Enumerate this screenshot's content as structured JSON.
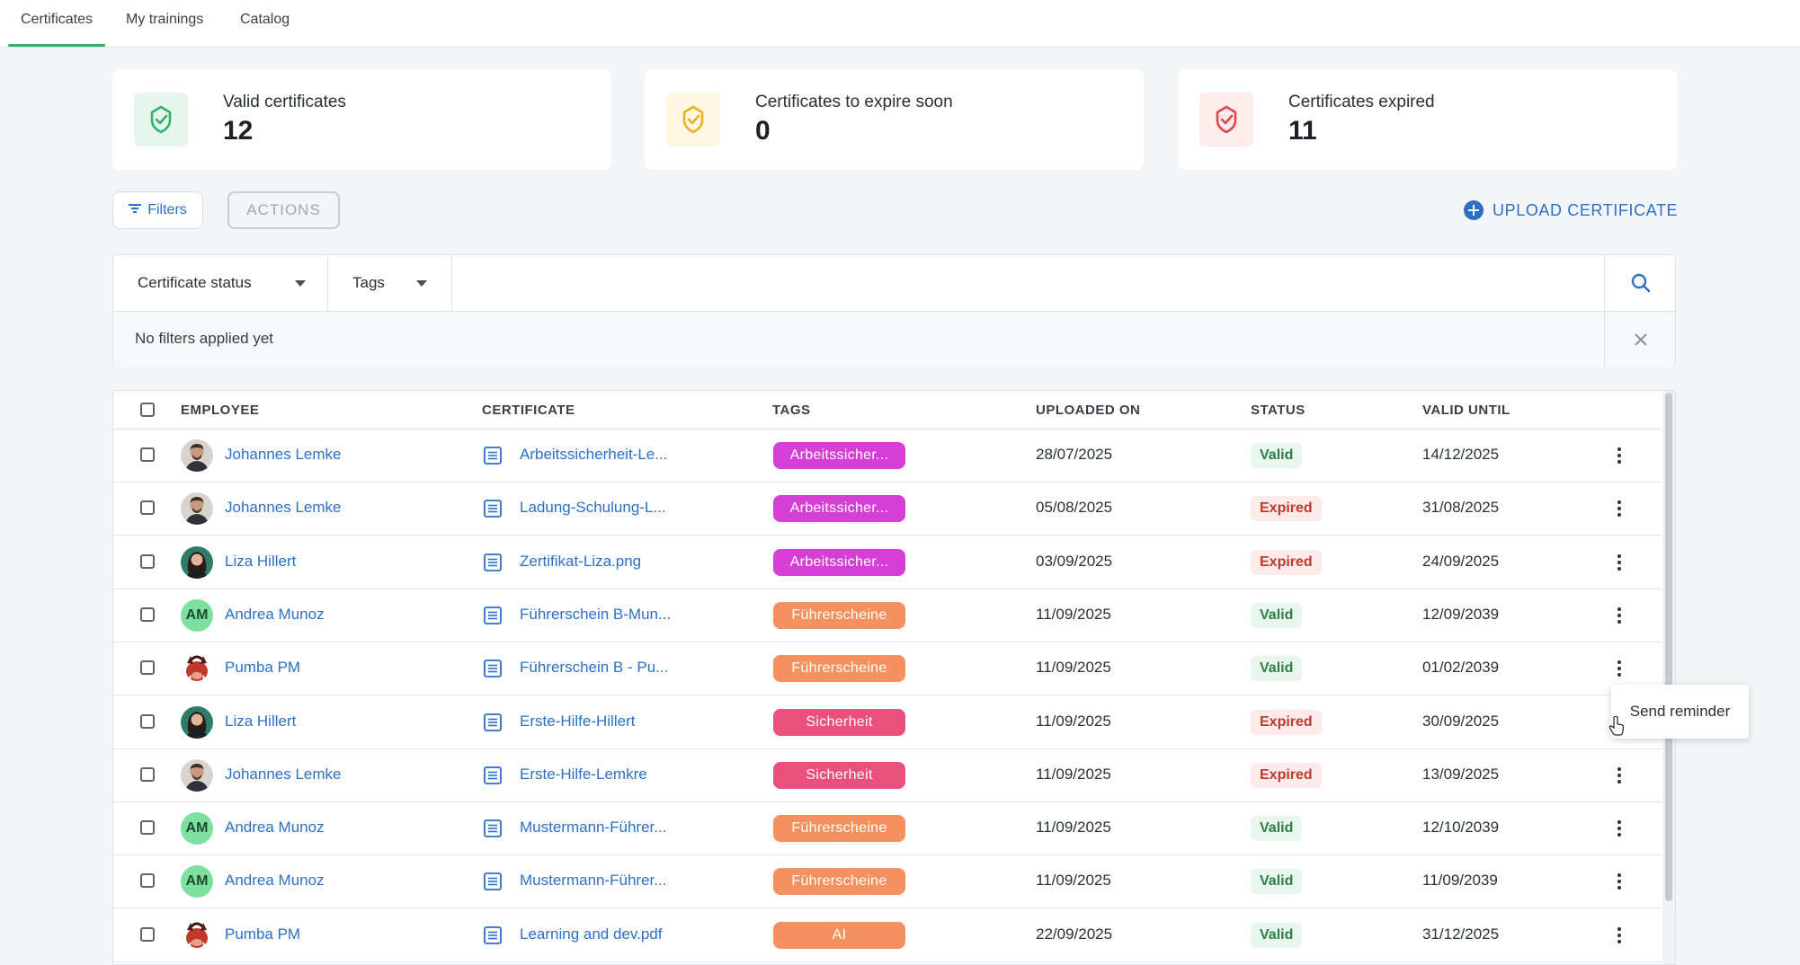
{
  "nav": {
    "tabs": [
      {
        "label": "Certificates",
        "active": true
      },
      {
        "label": "My trainings",
        "active": false
      },
      {
        "label": "Catalog",
        "active": false
      }
    ]
  },
  "stats": [
    {
      "label": "Valid certificates",
      "value": "12",
      "icon": "award-check-icon",
      "color": "#2fb36b"
    },
    {
      "label": "Certificates to expire soon",
      "value": "0",
      "icon": "award-warning-icon",
      "color": "#e6b31e"
    },
    {
      "label": "Certificates expired",
      "value": "11",
      "icon": "award-expired-icon",
      "color": "#e0454b"
    }
  ],
  "toolbar": {
    "filters_label": "Filters",
    "actions_label": "ACTIONS",
    "upload_label": "UPLOAD CERTIFICATE"
  },
  "filters": {
    "status_label": "Certificate status",
    "tags_label": "Tags",
    "search_placeholder": "",
    "no_filters_text": "No filters applied yet"
  },
  "table": {
    "columns": [
      "EMPLOYEE",
      "CERTIFICATE",
      "TAGS",
      "UPLOADED ON",
      "STATUS",
      "VALID UNTIL"
    ],
    "rows": [
      {
        "employee": "Johannes Lemke",
        "avatar": "photo-man",
        "certificate": "Arbeitssicherheit-Le...",
        "tag": "Arbeitssicher...",
        "tag_color": "#d63fd6",
        "uploaded": "28/07/2025",
        "status": "Valid",
        "valid_until": "14/12/2025"
      },
      {
        "employee": "Johannes Lemke",
        "avatar": "photo-man",
        "certificate": "Ladung-Schulung-L...",
        "tag": "Arbeitssicher...",
        "tag_color": "#d63fd6",
        "uploaded": "05/08/2025",
        "status": "Expired",
        "valid_until": "31/08/2025"
      },
      {
        "employee": "Liza Hillert",
        "avatar": "photo-woman",
        "certificate": "Zertifikat-Liza.png",
        "tag": "Arbeitssicher...",
        "tag_color": "#d63fd6",
        "uploaded": "03/09/2025",
        "status": "Expired",
        "valid_until": "24/09/2025"
      },
      {
        "employee": "Andrea Munoz",
        "avatar": "initials",
        "initials": "AM",
        "certificate": "Führerschein B-Mun...",
        "tag": "Führerscheine",
        "tag_color": "#f5915f",
        "uploaded": "11/09/2025",
        "status": "Valid",
        "valid_until": "12/09/2039"
      },
      {
        "employee": "Pumba PM",
        "avatar": "photo-pumba",
        "certificate": "Führerschein B - Pu...",
        "tag": "Führerscheine",
        "tag_color": "#f5915f",
        "uploaded": "11/09/2025",
        "status": "Valid",
        "valid_until": "01/02/2039"
      },
      {
        "employee": "Liza Hillert",
        "avatar": "photo-woman",
        "certificate": "Erste-Hilfe-Hillert",
        "tag": "Sicherheit",
        "tag_color": "#ea4f7e",
        "uploaded": "11/09/2025",
        "status": "Expired",
        "valid_until": "30/09/2025"
      },
      {
        "employee": "Johannes Lemke",
        "avatar": "photo-man",
        "certificate": "Erste-Hilfe-Lemkre",
        "tag": "Sicherheit",
        "tag_color": "#ea4f7e",
        "uploaded": "11/09/2025",
        "status": "Expired",
        "valid_until": "13/09/2025"
      },
      {
        "employee": "Andrea Munoz",
        "avatar": "initials",
        "initials": "AM",
        "certificate": "Mustermann-Führer...",
        "tag": "Führerscheine",
        "tag_color": "#f5915f",
        "uploaded": "11/09/2025",
        "status": "Valid",
        "valid_until": "12/10/2039"
      },
      {
        "employee": "Andrea Munoz",
        "avatar": "initials",
        "initials": "AM",
        "certificate": "Mustermann-Führer...",
        "tag": "Führerscheine",
        "tag_color": "#f5915f",
        "uploaded": "11/09/2025",
        "status": "Valid",
        "valid_until": "11/09/2039"
      },
      {
        "employee": "Pumba PM",
        "avatar": "photo-pumba",
        "certificate": "Learning and dev.pdf",
        "tag": "AI",
        "tag_color": "#f5915f",
        "uploaded": "22/09/2025",
        "status": "Valid",
        "valid_until": "31/12/2025"
      }
    ]
  },
  "tooltip": {
    "text": "Send reminder"
  }
}
